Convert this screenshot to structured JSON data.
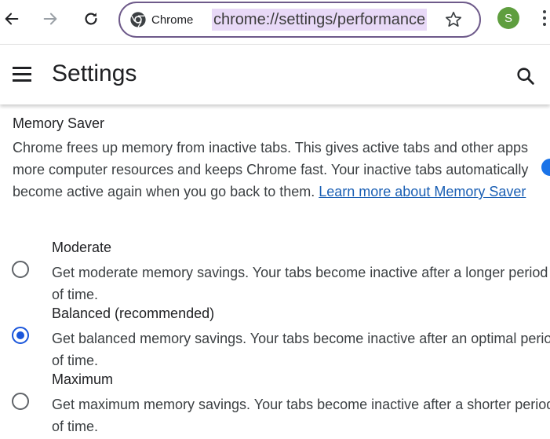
{
  "toolbar": {
    "site_chip_label": "Chrome",
    "url": "chrome://settings/performance",
    "avatar_letter": "S"
  },
  "header": {
    "title": "Settings"
  },
  "memory_saver": {
    "title": "Memory Saver",
    "description": "Chrome frees up memory from inactive tabs. This gives active tabs and other apps more computer resources and keeps Chrome fast. Your inactive tabs automatically become active again when you go back to them. ",
    "link_text": "Learn more about Memory Saver",
    "enabled": true
  },
  "options": [
    {
      "label": "Moderate",
      "description": "Get moderate memory savings. Your tabs become inactive after a longer period of time.",
      "selected": false
    },
    {
      "label": "Balanced (recommended)",
      "description": "Get balanced memory savings. Your tabs become inactive after an optimal period of time.",
      "selected": true
    },
    {
      "label": "Maximum",
      "description": "Get maximum memory savings. Your tabs become inactive after a shorter period of time.",
      "selected": false
    }
  ],
  "colors": {
    "accent": "#1a56db",
    "link": "#1a5fb4",
    "omnibox_border": "#6e5a8a",
    "url_highlight": "#e8d9f7",
    "avatar": "#5f9e3f"
  },
  "icons": {
    "back": "arrow-left-icon",
    "forward": "arrow-right-icon",
    "reload": "reload-icon",
    "site": "chrome-logo-icon",
    "bookmark": "star-icon",
    "menu": "hamburger-icon",
    "search": "search-icon",
    "more": "kebab-icon"
  }
}
